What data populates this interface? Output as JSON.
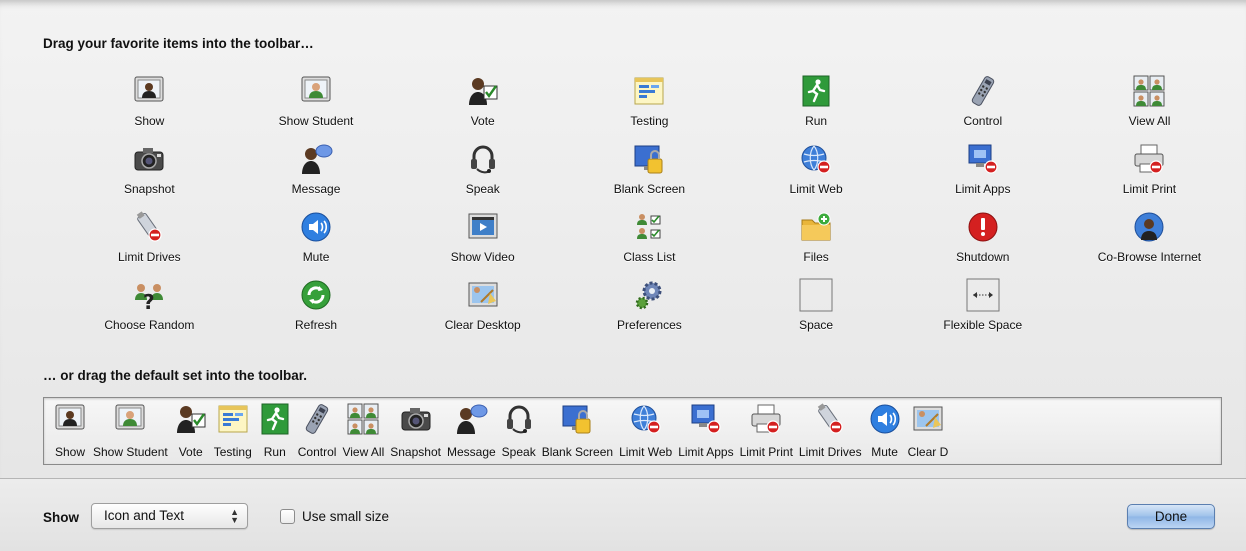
{
  "headings": {
    "favorites": "Drag your favorite items into the toolbar…",
    "default_set": "… or drag the default set into the toolbar."
  },
  "items": [
    {
      "label": "Show",
      "icon": "presenter-screen-icon"
    },
    {
      "label": "Show Student",
      "icon": "student-screen-icon"
    },
    {
      "label": "Vote",
      "icon": "vote-icon"
    },
    {
      "label": "Testing",
      "icon": "testing-icon"
    },
    {
      "label": "Run",
      "icon": "run-icon"
    },
    {
      "label": "Control",
      "icon": "remote-control-icon"
    },
    {
      "label": "View All",
      "icon": "view-all-icon"
    },
    {
      "label": "Snapshot",
      "icon": "camera-icon"
    },
    {
      "label": "Message",
      "icon": "message-icon"
    },
    {
      "label": "Speak",
      "icon": "headset-icon"
    },
    {
      "label": "Blank Screen",
      "icon": "blank-screen-icon"
    },
    {
      "label": "Limit Web",
      "icon": "limit-web-icon"
    },
    {
      "label": "Limit Apps",
      "icon": "limit-apps-icon"
    },
    {
      "label": "Limit Print",
      "icon": "limit-print-icon"
    },
    {
      "label": "Limit Drives",
      "icon": "limit-drives-icon"
    },
    {
      "label": "Mute",
      "icon": "speaker-icon"
    },
    {
      "label": "Show Video",
      "icon": "video-icon"
    },
    {
      "label": "Class List",
      "icon": "class-list-icon"
    },
    {
      "label": "Files",
      "icon": "folder-add-icon"
    },
    {
      "label": "Shutdown",
      "icon": "shutdown-icon"
    },
    {
      "label": "Co-Browse Internet",
      "icon": "co-browse-icon"
    },
    {
      "label": "Choose Random",
      "icon": "choose-random-icon"
    },
    {
      "label": "Refresh",
      "icon": "refresh-icon"
    },
    {
      "label": "Clear Desktop",
      "icon": "clear-desktop-icon"
    },
    {
      "label": "Preferences",
      "icon": "gears-icon"
    },
    {
      "label": "Space",
      "icon": "space-icon"
    },
    {
      "label": "Flexible Space",
      "icon": "flexible-space-icon"
    }
  ],
  "default_set": [
    {
      "label": "Show",
      "icon": "presenter-screen-icon"
    },
    {
      "label": "Show Student",
      "icon": "student-screen-icon"
    },
    {
      "label": "Vote",
      "icon": "vote-icon"
    },
    {
      "label": "Testing",
      "icon": "testing-icon"
    },
    {
      "label": "Run",
      "icon": "run-icon"
    },
    {
      "label": "Control",
      "icon": "remote-control-icon"
    },
    {
      "label": "View All",
      "icon": "view-all-icon"
    },
    {
      "label": "Snapshot",
      "icon": "camera-icon"
    },
    {
      "label": "Message",
      "icon": "message-icon"
    },
    {
      "label": "Speak",
      "icon": "headset-icon"
    },
    {
      "label": "Blank Screen",
      "icon": "blank-screen-icon"
    },
    {
      "label": "Limit Web",
      "icon": "limit-web-icon"
    },
    {
      "label": "Limit Apps",
      "icon": "limit-apps-icon"
    },
    {
      "label": "Limit Print",
      "icon": "limit-print-icon"
    },
    {
      "label": "Limit Drives",
      "icon": "limit-drives-icon"
    },
    {
      "label": "Mute",
      "icon": "speaker-icon"
    },
    {
      "label": "Clear D",
      "icon": "clear-desktop-icon"
    }
  ],
  "footer": {
    "show_label": "Show",
    "show_value": "Icon and Text",
    "small_size_label": "Use small size",
    "small_size_checked": false,
    "done_label": "Done"
  },
  "colors": {
    "done_button": "#9ec1ea",
    "sheet_bg": "#e9e9e9"
  }
}
